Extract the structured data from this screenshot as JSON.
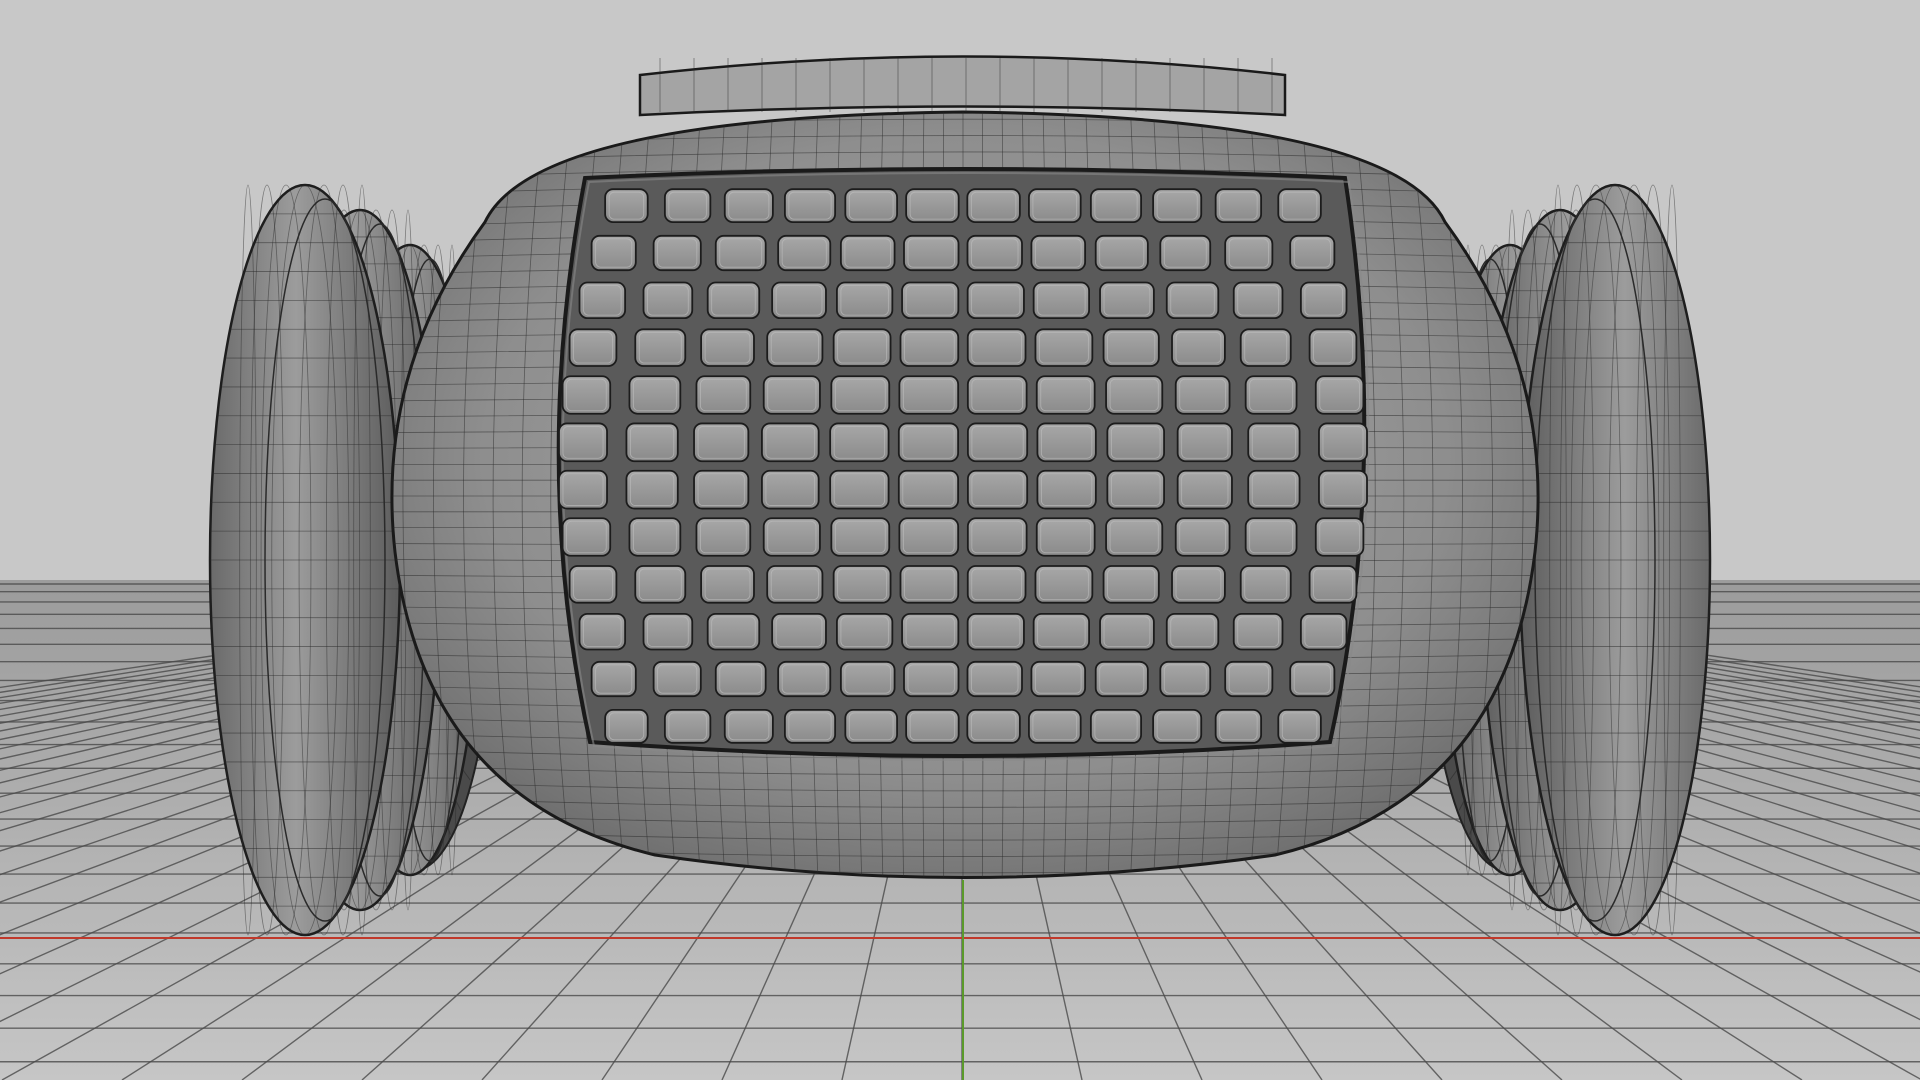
{
  "viewport": {
    "mode": "3d-viewport",
    "shading": "solid-wireframe",
    "background_color": "#c8c8c8",
    "grid_color": "#4a4a4a",
    "x_axis_color": "#c0392b",
    "y_axis_color": "#5a9a2a"
  },
  "model": {
    "name": "",
    "body_color": "#9a9a9a",
    "wire_color": "#2a2a2a",
    "panel_columns": 12,
    "panel_rows": 12,
    "wheels": 2
  }
}
